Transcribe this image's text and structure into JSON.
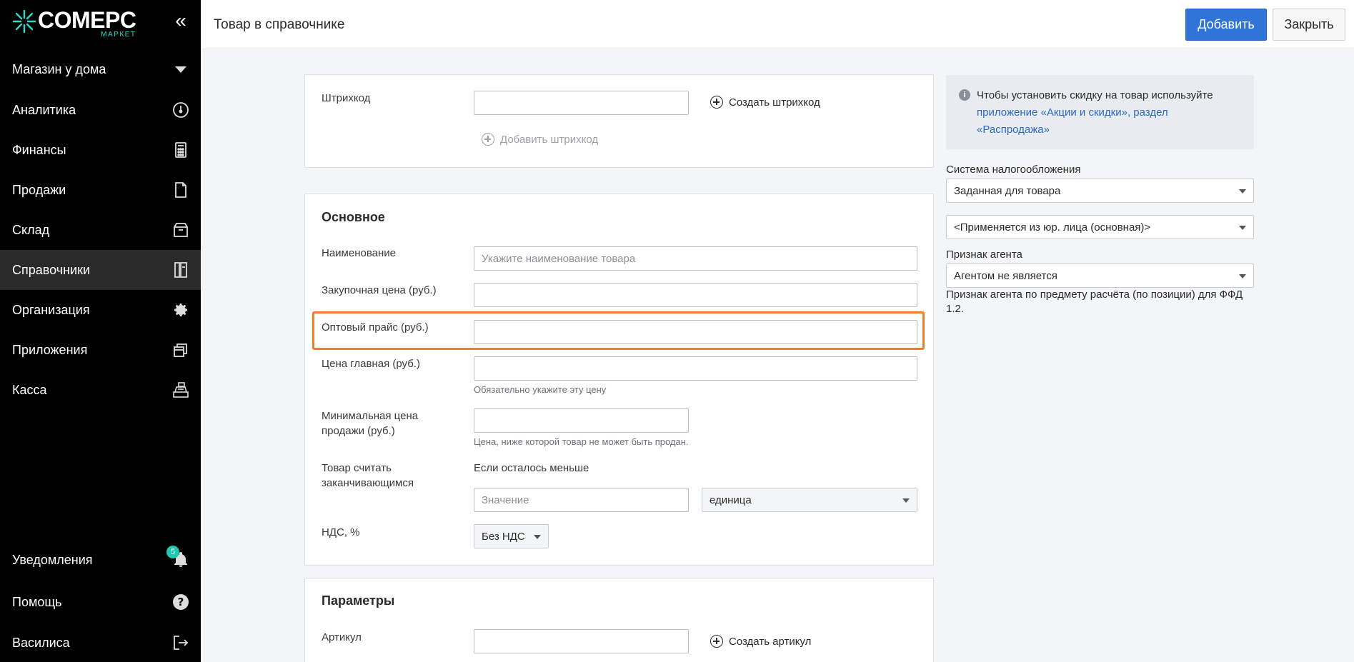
{
  "brand": {
    "name": "COMEPC",
    "sub": "МАРКЕТ",
    "accent": "#2bd9c6"
  },
  "sidebar": {
    "collapse_glyph": "«",
    "store": "Магазин у дома",
    "items": [
      {
        "label": "Аналитика",
        "icon": "speedometer-icon"
      },
      {
        "label": "Финансы",
        "icon": "calculator-icon"
      },
      {
        "label": "Продажи",
        "icon": "document-icon"
      },
      {
        "label": "Склад",
        "icon": "box-icon"
      },
      {
        "label": "Справочники",
        "icon": "book-icon",
        "active": true
      },
      {
        "label": "Организация",
        "icon": "gear-icon"
      },
      {
        "label": "Приложения",
        "icon": "windows-icon"
      },
      {
        "label": "Касса",
        "icon": "cash-register-icon"
      }
    ],
    "bottom": [
      {
        "label": "Уведомления",
        "icon": "bell-icon",
        "badge": "5"
      },
      {
        "label": "Помощь",
        "icon": "help-icon"
      },
      {
        "label": "Василиса",
        "icon": "logout-icon"
      }
    ]
  },
  "header": {
    "title": "Товар в справочнике",
    "add_label": "Добавить",
    "close_label": "Закрыть",
    "primary_color": "#2f74d6"
  },
  "barcode": {
    "label": "Штрихкод",
    "value": "",
    "create_label": "Создать штрихкод",
    "add_label": "Добавить штрихкод"
  },
  "main": {
    "title": "Основное",
    "name": {
      "label": "Наименование",
      "placeholder": "Укажите наименование товара",
      "value": ""
    },
    "purchase_price": {
      "label": "Закупочная цена (руб.)",
      "value": ""
    },
    "wholesale_price": {
      "label": "Оптовый прайс (руб.)",
      "value": ""
    },
    "main_price": {
      "label": "Цена главная (руб.)",
      "value": "",
      "hint": "Обязательно укажите эту цену"
    },
    "min_price": {
      "label_line1": "Минимальная цена",
      "label_line2": "продажи (руб.)",
      "value": "",
      "hint": "Цена, ниже которой товар не может быть продан."
    },
    "running_out": {
      "label_line1": "Товар считать",
      "label_line2": "заканчивающимся",
      "condition": "Если осталось меньше",
      "placeholder": "Значение",
      "unit": "единица"
    },
    "vat": {
      "label": "НДС, %",
      "value": "Без НДС"
    }
  },
  "params": {
    "title": "Параметры",
    "article_label": "Артикул",
    "article_value": "",
    "create_article_label": "Создать артикул"
  },
  "right": {
    "info_text": "Чтобы установить скидку на товар используйте ",
    "info_link": "приложение «Акции и скидки», раздел «Распродажа»",
    "tax_label": "Система налогообложения",
    "tax_value": "Заданная для товара",
    "entity_value": "<Применяется из юр. лица (основная)>",
    "agent_label": "Признак агента",
    "agent_value": "Агентом не является",
    "agent_note": "Признак агента по предмету расчёта (по позиции) для ФФД 1.2."
  },
  "highlight_color": "#f47a2c"
}
